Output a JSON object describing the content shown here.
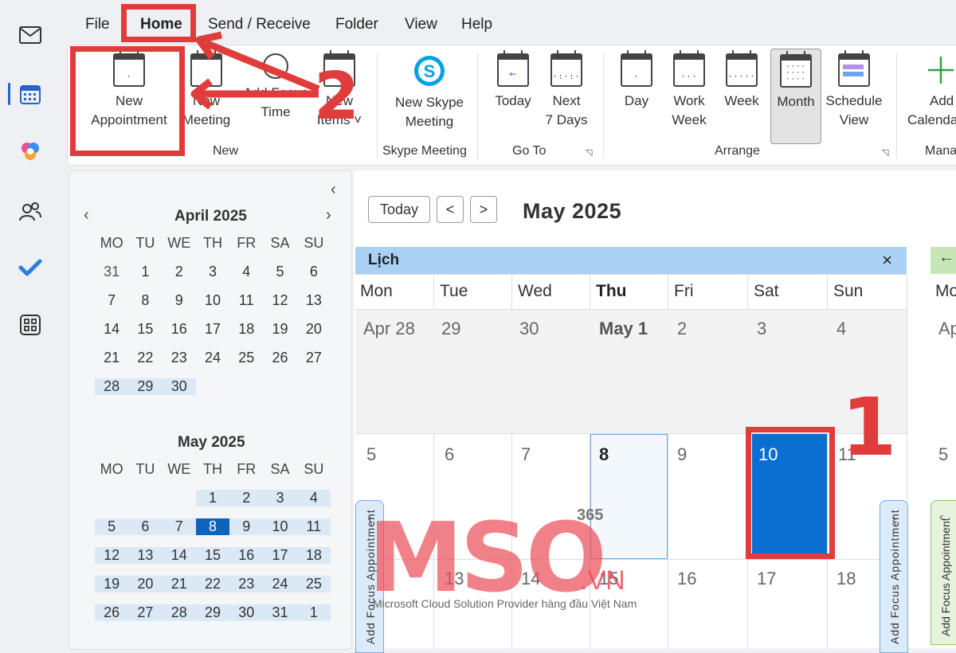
{
  "menu": [
    "File",
    "Home",
    "Send / Receive",
    "Folder",
    "View",
    "Help"
  ],
  "ribbon": {
    "new_appointment": [
      "New",
      "Appointment"
    ],
    "new_meeting": [
      "New",
      "Meeting"
    ],
    "add_focus_time": [
      "Add Focus",
      "Time"
    ],
    "new_items": [
      "New",
      "Items ˅"
    ],
    "new_skype_meeting": [
      "New Skype",
      "Meeting"
    ],
    "today": [
      "Today",
      ""
    ],
    "next_7_days": [
      "Next",
      "7 Days"
    ],
    "day": [
      "Day",
      ""
    ],
    "work_week": [
      "Work",
      "Week"
    ],
    "week": [
      "Week",
      ""
    ],
    "month": [
      "Month",
      ""
    ],
    "schedule_view": [
      "Schedule",
      "View"
    ],
    "add_calendar": [
      "Add",
      "Calenda"
    ],
    "groups": {
      "new": "New",
      "skype": "Skype Meeting",
      "goto": "Go To",
      "arrange": "Arrange",
      "manage": "Mana"
    }
  },
  "mini_calendars": [
    {
      "title": "April 2025",
      "weekdays": [
        "MO",
        "TU",
        "WE",
        "TH",
        "FR",
        "SA",
        "SU"
      ],
      "rows": [
        [
          "31",
          "1",
          "2",
          "3",
          "4",
          "5",
          "6"
        ],
        [
          "7",
          "8",
          "9",
          "10",
          "11",
          "12",
          "13"
        ],
        [
          "14",
          "15",
          "16",
          "17",
          "18",
          "19",
          "20"
        ],
        [
          "21",
          "22",
          "23",
          "24",
          "25",
          "26",
          "27"
        ],
        [
          "28",
          "29",
          "30",
          "",
          "",
          "",
          ""
        ]
      ]
    },
    {
      "title": "May 2025",
      "weekdays": [
        "MO",
        "TU",
        "WE",
        "TH",
        "FR",
        "SA",
        "SU"
      ],
      "rows": [
        [
          "",
          "",
          "",
          "1",
          "2",
          "3",
          "4"
        ],
        [
          "5",
          "6",
          "7",
          "8",
          "9",
          "10",
          "11"
        ],
        [
          "12",
          "13",
          "14",
          "15",
          "16",
          "17",
          "18"
        ],
        [
          "19",
          "20",
          "21",
          "22",
          "23",
          "24",
          "25"
        ],
        [
          "26",
          "27",
          "28",
          "29",
          "30",
          "31",
          "1"
        ]
      ],
      "selected": "8"
    }
  ],
  "main": {
    "today_button": "Today",
    "prev": "<",
    "next": ">",
    "month_title": "May 2025",
    "calendar_name": "Lịch",
    "close": "×",
    "weekdays": [
      "Mon",
      "Tue",
      "Wed",
      "Thu",
      "Fri",
      "Sat",
      "Sun"
    ],
    "week1": [
      "Apr 28",
      "29",
      "30",
      "May 1",
      "2",
      "3",
      "4"
    ],
    "week2": [
      "5",
      "6",
      "7",
      "8",
      "9",
      "10",
      "11"
    ],
    "week3": [
      "12",
      "13",
      "14",
      "15",
      "16",
      "17",
      "18"
    ],
    "side_tab_label": "Add Focus Appointment",
    "next_calendar": {
      "weekday": "Mo",
      "day1": "Ap",
      "day2": "5"
    }
  },
  "annotations": {
    "step1": "1",
    "step2": "2"
  },
  "watermark": {
    "logo": "MSO",
    "small": "365",
    "vn": ".VN",
    "tagline": "Microsoft Cloud Solution Provider hàng đầu Việt Nam"
  },
  "colors": {
    "accent": "#0e64b8",
    "annotation": "#e03c3c",
    "calendar_header": "#a9d1f3",
    "selected_cell": "#0a6fd0"
  }
}
